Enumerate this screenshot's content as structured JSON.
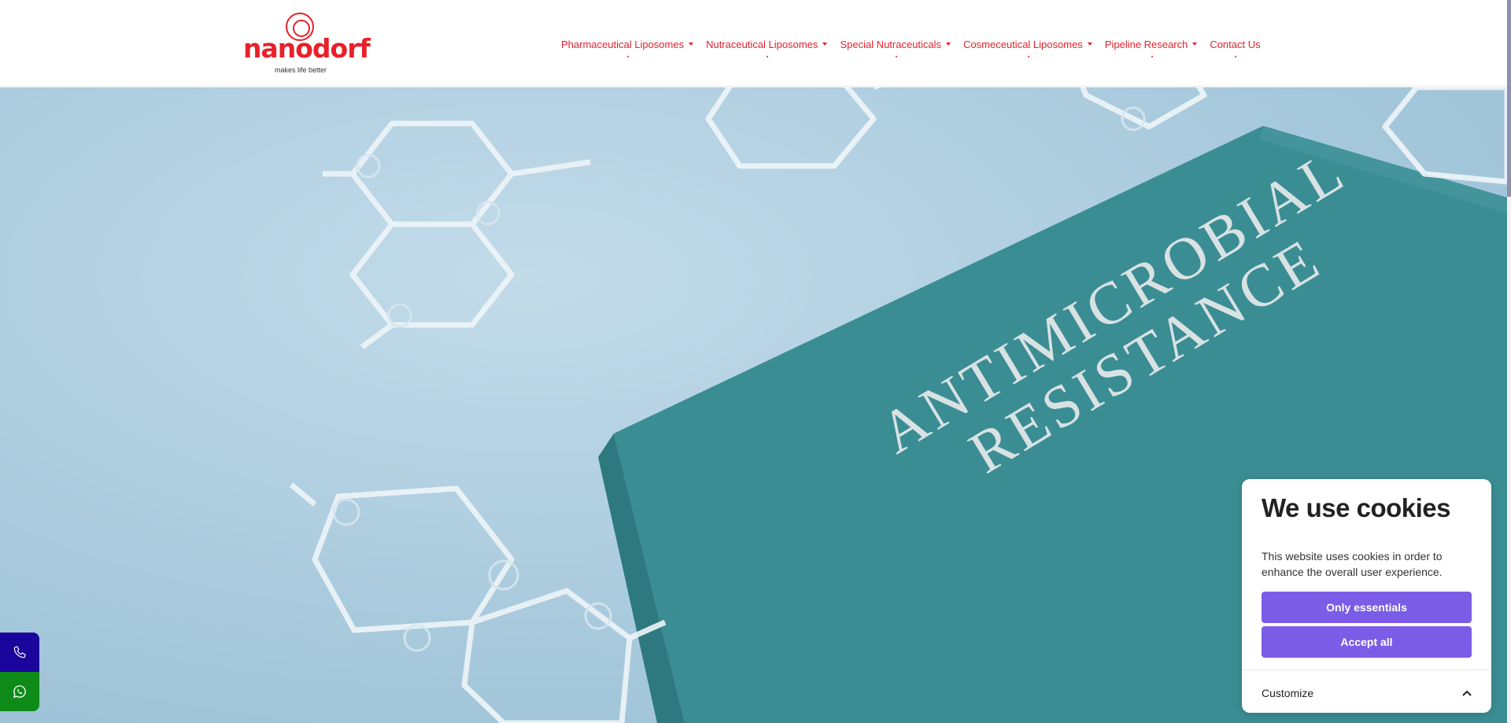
{
  "logo": {
    "wordmark": "nanodorf",
    "tagline": "makes life better",
    "brand_color": "#e8202a"
  },
  "nav": {
    "items": [
      {
        "label": "Pharmaceutical Liposomes",
        "dropdown": true
      },
      {
        "label": "Nutraceutical Liposomes",
        "dropdown": true
      },
      {
        "label": "Special Nutraceuticals",
        "dropdown": true
      },
      {
        "label": "Cosmeceutical Liposomes",
        "dropdown": true
      },
      {
        "label": "Pipeline Research",
        "dropdown": true
      },
      {
        "label": "Contact Us",
        "dropdown": false
      }
    ]
  },
  "hero": {
    "book_title_line1": "ANTIMICROBIAL",
    "book_title_line2": "RESISTANCE"
  },
  "floating": {
    "phone_icon": "phone-icon",
    "phone_color": "#1a049c",
    "whatsapp_icon": "whatsapp-icon",
    "whatsapp_color": "#0d8a18"
  },
  "cookie": {
    "title": "We use cookies",
    "text": "This website uses cookies in order to enhance the overall user experience.",
    "only_essentials": "Only essentials",
    "accept_all": "Accept all",
    "customize": "Customize",
    "button_color": "#7b5ce6"
  }
}
